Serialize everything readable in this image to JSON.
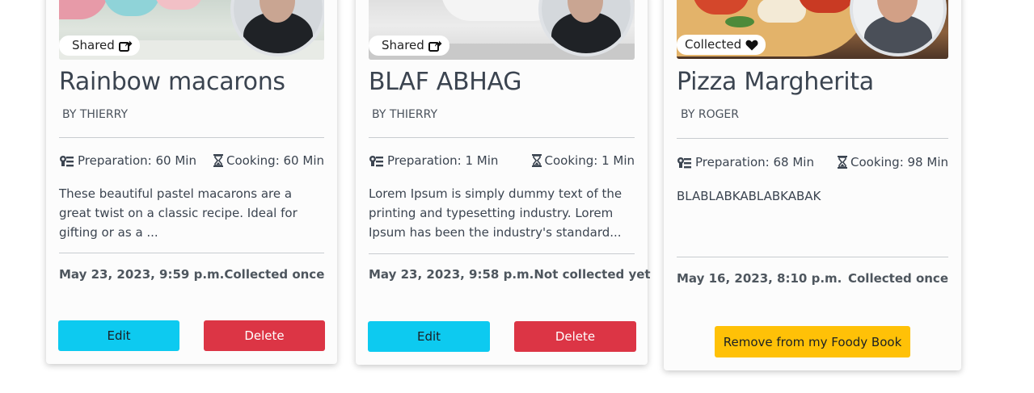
{
  "cards": [
    {
      "badge": "Shared",
      "badge_icon": "share-square-icon",
      "title": "Rainbow macarons",
      "author": "BY THIERRY",
      "preparation": "Preparation: 60 Min",
      "cooking": "Cooking: 60 Min",
      "description": "These beautiful pastel macarons are a great twist on a classic recipe. Ideal for gifting or as a ...",
      "date": "May 23, 2023, 9:59 p.m.",
      "collected": "Collected once",
      "edit_label": "Edit",
      "delete_label": "Delete"
    },
    {
      "badge": "Shared",
      "badge_icon": "share-square-icon",
      "title": "BLAF ABHAG",
      "author": "BY THIERRY",
      "preparation": "Preparation: 1 Min",
      "cooking": "Cooking: 1 Min",
      "description": "Lorem Ipsum is simply dummy text of the printing and typesetting industry. Lorem Ipsum has been the industry's standard...",
      "date": "May 23, 2023, 9:58 p.m.",
      "collected": "Not collected yet",
      "edit_label": "Edit",
      "delete_label": "Delete"
    },
    {
      "badge": "Collected",
      "badge_icon": "heart-icon",
      "title": "Pizza Margherita",
      "author": "BY ROGER",
      "preparation": "Preparation: 68 Min",
      "cooking": "Cooking: 98 Min",
      "description": "BLABLABKABLABKABAK",
      "date": "May 16, 2023, 8:10 p.m.",
      "collected": "Collected once",
      "remove_label": "Remove from my Foody Book"
    }
  ],
  "colors": {
    "edit": "#0dcaf0",
    "delete": "#dc3545",
    "remove": "#ffc107"
  }
}
